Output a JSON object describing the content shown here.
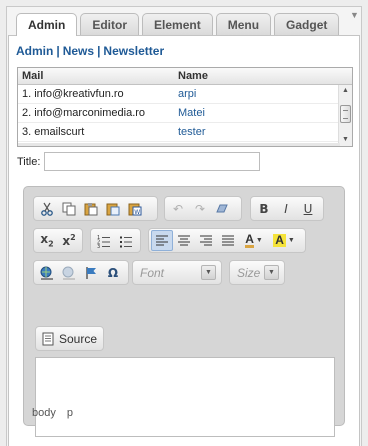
{
  "tabs": [
    {
      "label": "Admin",
      "active": true
    },
    {
      "label": "Editor"
    },
    {
      "label": "Element"
    },
    {
      "label": "Menu"
    },
    {
      "label": "Gadget"
    }
  ],
  "breadcrumb": {
    "items": [
      "Admin",
      "News",
      "Newsletter"
    ],
    "separator": "|"
  },
  "table": {
    "columns": [
      "Mail",
      "Name"
    ],
    "rows": [
      {
        "mail": "1. info@kreativfun.ro",
        "name": "arpi"
      },
      {
        "mail": "2. info@marconimedia.ro",
        "name": "Matei"
      },
      {
        "mail": "3. emailscurt",
        "name": "tester"
      }
    ]
  },
  "title_field": {
    "label": "Title:",
    "value": ""
  },
  "editor": {
    "font_placeholder": "Font",
    "size_placeholder": "Size",
    "source_label": "Source",
    "status_path": [
      "body",
      "p"
    ]
  },
  "colors": {
    "link": "#1f5a96",
    "accent_active": "#c8d9ee"
  }
}
